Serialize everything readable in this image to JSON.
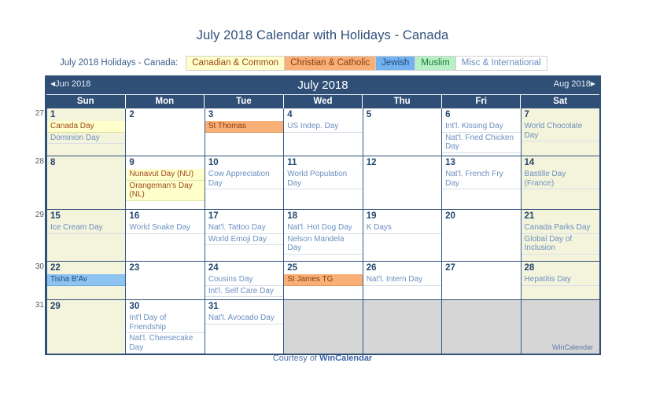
{
  "page": {
    "title": "July 2018 Calendar with Holidays - Canada"
  },
  "legend": {
    "label": "July 2018 Holidays - Canada:",
    "items": [
      {
        "label": "Canadian & Common",
        "key": "canadian",
        "color": "#ffffcc"
      },
      {
        "label": "Christian & Catholic",
        "key": "christian",
        "color": "#f8b077"
      },
      {
        "label": "Jewish",
        "key": "jewish",
        "color": "#74b2ef"
      },
      {
        "label": "Muslim",
        "key": "muslim",
        "color": "#b6f0c4"
      },
      {
        "label": "Misc & International",
        "key": "misc",
        "color": "#ffffff"
      }
    ]
  },
  "calendar": {
    "prev_month": "Jun 2018",
    "month_title": "July 2018",
    "next_month": "Aug 2018",
    "prev_arrow": "◀",
    "next_arrow": "▶",
    "day_headers": [
      "Sun",
      "Mon",
      "Tue",
      "Wed",
      "Thu",
      "Fri",
      "Sat"
    ],
    "watermark": "WinCalendar",
    "weeks": [
      {
        "number": "27",
        "days": [
          {
            "num": "1",
            "weekend": true,
            "events": [
              {
                "text": "Canada Day",
                "cat": "canadian"
              },
              {
                "text": "Dominion Day",
                "cat": "misc"
              }
            ]
          },
          {
            "num": "2",
            "weekend": false,
            "events": []
          },
          {
            "num": "3",
            "weekend": false,
            "events": [
              {
                "text": "St Thomas",
                "cat": "christian"
              }
            ]
          },
          {
            "num": "4",
            "weekend": false,
            "events": [
              {
                "text": "US Indep. Day",
                "cat": "misc"
              }
            ]
          },
          {
            "num": "5",
            "weekend": false,
            "events": []
          },
          {
            "num": "6",
            "weekend": false,
            "events": [
              {
                "text": "Int'l. Kissing Day",
                "cat": "misc"
              },
              {
                "text": "Nat'l. Fried Chicken Day",
                "cat": "misc"
              }
            ]
          },
          {
            "num": "7",
            "weekend": true,
            "events": [
              {
                "text": "World Chocolate Day",
                "cat": "misc"
              }
            ]
          }
        ]
      },
      {
        "number": "28",
        "days": [
          {
            "num": "8",
            "weekend": true,
            "events": []
          },
          {
            "num": "9",
            "weekend": false,
            "events": [
              {
                "text": "Nunavut Day (NU)",
                "cat": "canadian"
              },
              {
                "text": "Orangeman's Day (NL)",
                "cat": "canadian"
              }
            ]
          },
          {
            "num": "10",
            "weekend": false,
            "events": [
              {
                "text": "Cow Appreciation Day",
                "cat": "misc"
              }
            ]
          },
          {
            "num": "11",
            "weekend": false,
            "events": [
              {
                "text": "World Population Day",
                "cat": "misc"
              }
            ]
          },
          {
            "num": "12",
            "weekend": false,
            "events": []
          },
          {
            "num": "13",
            "weekend": false,
            "events": [
              {
                "text": "Nat'l. French Fry Day",
                "cat": "misc"
              }
            ]
          },
          {
            "num": "14",
            "weekend": true,
            "events": [
              {
                "text": "Bastille Day (France)",
                "cat": "misc"
              }
            ]
          }
        ]
      },
      {
        "number": "29",
        "days": [
          {
            "num": "15",
            "weekend": true,
            "events": [
              {
                "text": "Ice Cream Day",
                "cat": "misc"
              }
            ]
          },
          {
            "num": "16",
            "weekend": false,
            "events": [
              {
                "text": "World Snake Day",
                "cat": "misc"
              }
            ]
          },
          {
            "num": "17",
            "weekend": false,
            "events": [
              {
                "text": "Nat'l. Tattoo Day",
                "cat": "misc"
              },
              {
                "text": "World Emoji Day",
                "cat": "misc"
              }
            ]
          },
          {
            "num": "18",
            "weekend": false,
            "events": [
              {
                "text": "Nat'l. Hot Dog Day",
                "cat": "misc"
              },
              {
                "text": "Nelson Mandela Day",
                "cat": "misc"
              }
            ]
          },
          {
            "num": "19",
            "weekend": false,
            "events": [
              {
                "text": "K Days",
                "cat": "misc"
              }
            ]
          },
          {
            "num": "20",
            "weekend": false,
            "events": []
          },
          {
            "num": "21",
            "weekend": true,
            "events": [
              {
                "text": "Canada Parks Day",
                "cat": "misc"
              },
              {
                "text": "Global Day of Inclusion",
                "cat": "misc"
              }
            ]
          }
        ]
      },
      {
        "number": "30",
        "days": [
          {
            "num": "22",
            "weekend": true,
            "events": [
              {
                "text": "Tisha B'Av",
                "cat": "jewish"
              }
            ]
          },
          {
            "num": "23",
            "weekend": false,
            "events": []
          },
          {
            "num": "24",
            "weekend": false,
            "events": [
              {
                "text": "Cousins Day",
                "cat": "misc"
              },
              {
                "text": "Int'l. Self Care Day",
                "cat": "misc"
              }
            ]
          },
          {
            "num": "25",
            "weekend": false,
            "events": [
              {
                "text": "St James TG",
                "cat": "christian"
              }
            ]
          },
          {
            "num": "26",
            "weekend": false,
            "events": [
              {
                "text": "Nat'l. Intern Day",
                "cat": "misc"
              }
            ]
          },
          {
            "num": "27",
            "weekend": false,
            "events": []
          },
          {
            "num": "28",
            "weekend": true,
            "events": [
              {
                "text": "Hepatitis Day",
                "cat": "misc"
              }
            ]
          }
        ]
      },
      {
        "number": "31",
        "days": [
          {
            "num": "29",
            "weekend": true,
            "events": []
          },
          {
            "num": "30",
            "weekend": false,
            "events": [
              {
                "text": "Int'l Day of Friendship",
                "cat": "misc"
              },
              {
                "text": "Nat'l. Cheesecake Day",
                "cat": "misc"
              }
            ]
          },
          {
            "num": "31",
            "weekend": false,
            "events": [
              {
                "text": "Nat'l. Avocado Day",
                "cat": "misc"
              }
            ]
          },
          {
            "num": "",
            "weekend": false,
            "blank": true,
            "events": []
          },
          {
            "num": "",
            "weekend": false,
            "blank": true,
            "events": []
          },
          {
            "num": "",
            "weekend": false,
            "blank": true,
            "events": []
          },
          {
            "num": "",
            "weekend": false,
            "blank": true,
            "events": []
          }
        ]
      }
    ]
  },
  "footer": {
    "prefix": "Courtesy of ",
    "brand": "WinCalendar"
  }
}
